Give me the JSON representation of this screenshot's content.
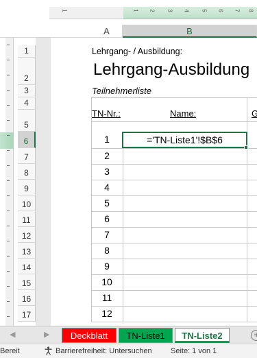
{
  "column_headers": [
    "A",
    "B"
  ],
  "row_headers": [
    "1",
    "2",
    "3",
    "4",
    "5",
    "6",
    "7",
    "8",
    "9",
    "10",
    "11",
    "12",
    "13",
    "14",
    "15",
    "16",
    "17"
  ],
  "ruler_numbers": [
    "1",
    "1",
    "2",
    "3",
    "4",
    "5",
    "6",
    "7",
    "8",
    "9"
  ],
  "cells": {
    "line1": "Lehrgang- / Ausbildung:",
    "title": "Lehrgang-Ausbildung",
    "subtitle": "Teilnehmerliste",
    "hdr_tn": "TN-Nr.:",
    "hdr_name": "Name:",
    "hdr_g": "G",
    "formula": "='TN-Liste1'!$B$6"
  },
  "tn_numbers": [
    "1",
    "2",
    "3",
    "4",
    "5",
    "6",
    "7",
    "8",
    "9",
    "10",
    "11",
    "12"
  ],
  "sheet_tabs": {
    "deckblatt": "Deckblatt",
    "tn1": "TN-Liste1",
    "tn2": "TN-Liste2",
    "add": "+"
  },
  "nav": {
    "prev": "◀",
    "next": "▶"
  },
  "status": {
    "ready": "Bereit",
    "accessibility": "Barrierefreiheit: Untersuchen",
    "page": "Seite: 1 von 1"
  },
  "colors": {
    "accent": "#217346",
    "tab_deckblatt": "#ff0000",
    "tab_tn1": "#00a550"
  }
}
